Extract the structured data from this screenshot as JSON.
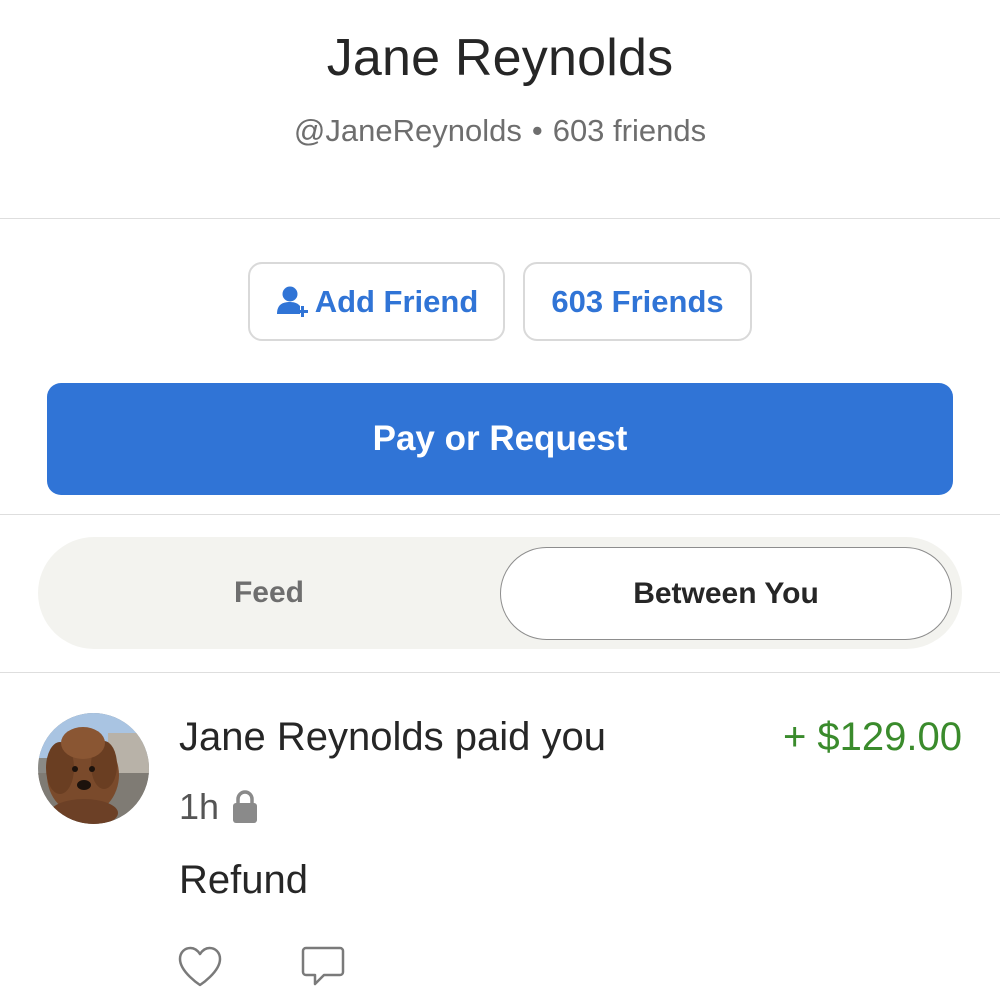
{
  "profile": {
    "name": "Jane Reynolds",
    "username": "@JaneReynolds",
    "separator": "•",
    "friends_text": "603 friends"
  },
  "actions": {
    "add_friend_label": "Add Friend",
    "friends_button_label": "603 Friends",
    "pay_request_label": "Pay or Request"
  },
  "tabs": {
    "items": [
      {
        "label": "Feed",
        "selected": false
      },
      {
        "label": "Between You",
        "selected": true
      }
    ]
  },
  "transaction": {
    "actor": "Jane Reynolds",
    "action_text": "paid you",
    "amount": "+ $129.00",
    "time": "1h",
    "privacy_icon": "lock-icon",
    "note": "Refund"
  },
  "colors": {
    "accent_blue": "#3074d6",
    "amount_green": "#3a8b2c"
  }
}
